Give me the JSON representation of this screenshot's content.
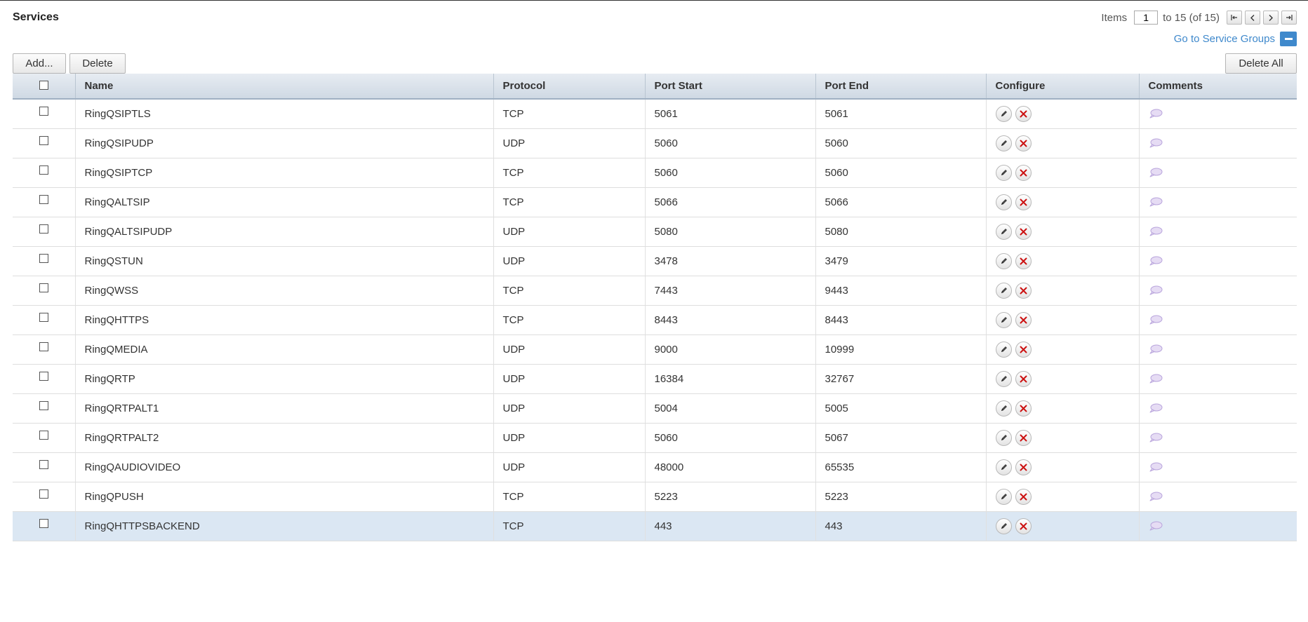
{
  "page": {
    "title": "Services"
  },
  "pager": {
    "items_label": "Items",
    "current": "1",
    "range_text": "to 15 (of 15)",
    "first_icon": "first-page-icon",
    "prev_icon": "prev-page-icon",
    "next_icon": "next-page-icon",
    "last_icon": "last-page-icon"
  },
  "goto_link": {
    "label": "Go to Service Groups",
    "icon": "collapse-minus-icon"
  },
  "toolbar": {
    "add_label": "Add...",
    "delete_label": "Delete",
    "delete_all_label": "Delete All"
  },
  "table": {
    "columns": [
      "Name",
      "Protocol",
      "Port Start",
      "Port End",
      "Configure",
      "Comments"
    ],
    "rows": [
      {
        "name": "RingQSIPTLS",
        "protocol": "TCP",
        "port_start": "5061",
        "port_end": "5061"
      },
      {
        "name": "RingQSIPUDP",
        "protocol": "UDP",
        "port_start": "5060",
        "port_end": "5060"
      },
      {
        "name": "RingQSIPTCP",
        "protocol": "TCP",
        "port_start": "5060",
        "port_end": "5060"
      },
      {
        "name": "RingQALTSIP",
        "protocol": "TCP",
        "port_start": "5066",
        "port_end": "5066"
      },
      {
        "name": "RingQALTSIPUDP",
        "protocol": "UDP",
        "port_start": "5080",
        "port_end": "5080"
      },
      {
        "name": "RingQSTUN",
        "protocol": "UDP",
        "port_start": "3478",
        "port_end": "3479"
      },
      {
        "name": "RingQWSS",
        "protocol": "TCP",
        "port_start": "7443",
        "port_end": "9443"
      },
      {
        "name": "RingQHTTPS",
        "protocol": "TCP",
        "port_start": "8443",
        "port_end": "8443"
      },
      {
        "name": "RingQMEDIA",
        "protocol": "UDP",
        "port_start": "9000",
        "port_end": "10999"
      },
      {
        "name": "RingQRTP",
        "protocol": "UDP",
        "port_start": "16384",
        "port_end": "32767"
      },
      {
        "name": "RingQRTPALT1",
        "protocol": "UDP",
        "port_start": "5004",
        "port_end": "5005"
      },
      {
        "name": "RingQRTPALT2",
        "protocol": "UDP",
        "port_start": "5060",
        "port_end": "5067"
      },
      {
        "name": "RingQAUDIOVIDEO",
        "protocol": "UDP",
        "port_start": "48000",
        "port_end": "65535"
      },
      {
        "name": "RingQPUSH",
        "protocol": "TCP",
        "port_start": "5223",
        "port_end": "5223"
      },
      {
        "name": "RingQHTTPSBACKEND",
        "protocol": "TCP",
        "port_start": "443",
        "port_end": "443",
        "selected": true
      }
    ],
    "icons": {
      "edit": "edit-pencil-icon",
      "delete": "delete-x-icon",
      "comment": "comment-bubble-icon"
    }
  },
  "colors": {
    "header_bg": "#cfd9e4",
    "link": "#3f89cc",
    "selected_row": "#dbe7f3",
    "delete_icon": "#cc1111",
    "comment_icon": "#c9b7e3"
  }
}
